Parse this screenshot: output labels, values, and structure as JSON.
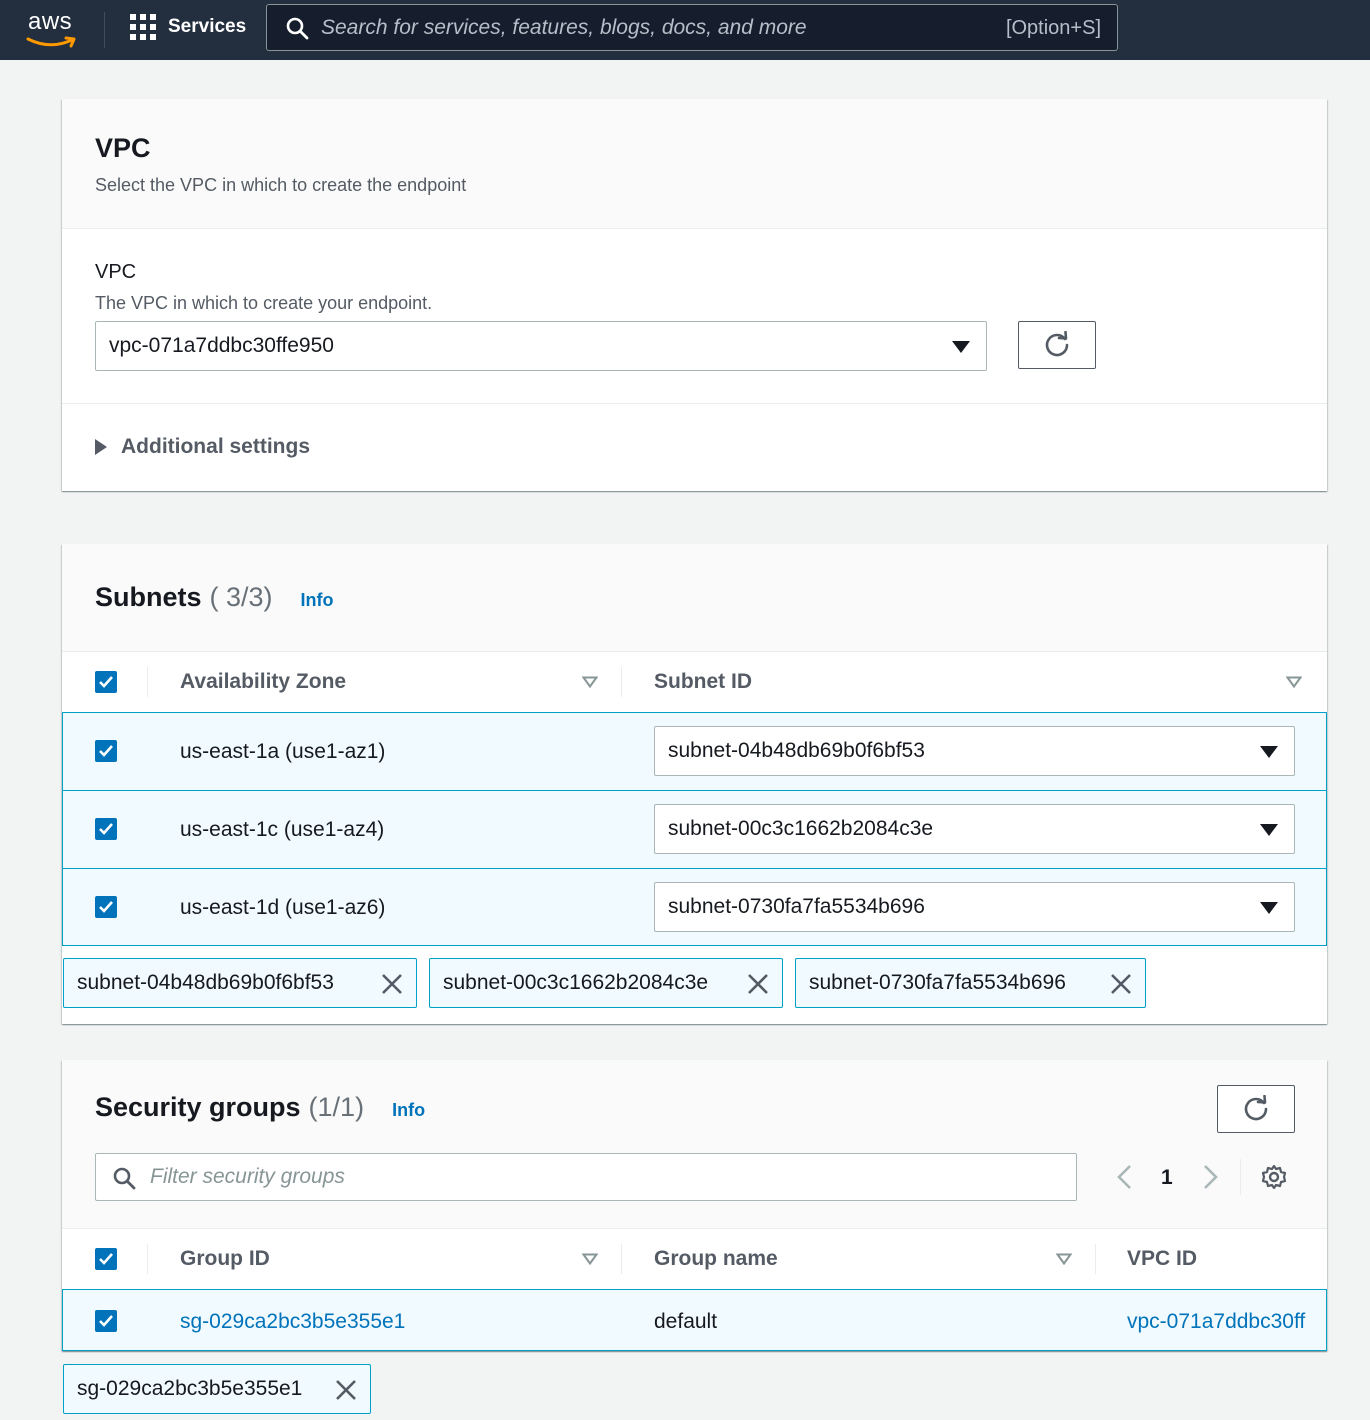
{
  "nav": {
    "logo": "aws",
    "services_label": "Services",
    "search_placeholder": "Search for services, features, blogs, docs, and more",
    "search_shortcut": "[Option+S]"
  },
  "vpc_panel": {
    "title": "VPC",
    "subtitle": "Select the VPC in which to create the endpoint",
    "field_label": "VPC",
    "field_desc": "The VPC in which to create your endpoint.",
    "selected_vpc": "vpc-071a7ddbc30ffe950",
    "additional_settings": "Additional settings"
  },
  "subnets_panel": {
    "title": "Subnets",
    "count": "( 3/3)",
    "info": "Info",
    "col_az": "Availability Zone",
    "col_subnet": "Subnet ID",
    "rows": [
      {
        "az": "us-east-1a (use1-az1)",
        "subnet": "subnet-04b48db69b0f6bf53"
      },
      {
        "az": "us-east-1c (use1-az4)",
        "subnet": "subnet-00c3c1662b2084c3e"
      },
      {
        "az": "us-east-1d (use1-az6)",
        "subnet": "subnet-0730fa7fa5534b696"
      }
    ],
    "tokens": [
      "subnet-04b48db69b0f6bf53",
      "subnet-00c3c1662b2084c3e",
      "subnet-0730fa7fa5534b696"
    ]
  },
  "sg_panel": {
    "title": "Security groups",
    "count": "(1/1)",
    "info": "Info",
    "filter_placeholder": "Filter security groups",
    "page": "1",
    "col_group_id": "Group ID",
    "col_group_name": "Group name",
    "col_vpc_id": "VPC ID",
    "rows": [
      {
        "group_id": "sg-029ca2bc3b5e355e1",
        "group_name": "default",
        "vpc_id": "vpc-071a7ddbc30ff"
      }
    ],
    "tokens": [
      "sg-029ca2bc3b5e355e1"
    ]
  },
  "colors": {
    "nav_bg": "#232f3e",
    "link": "#0073bb",
    "selected_row_bg": "#f1faff",
    "selected_border": "#00a1c9"
  }
}
